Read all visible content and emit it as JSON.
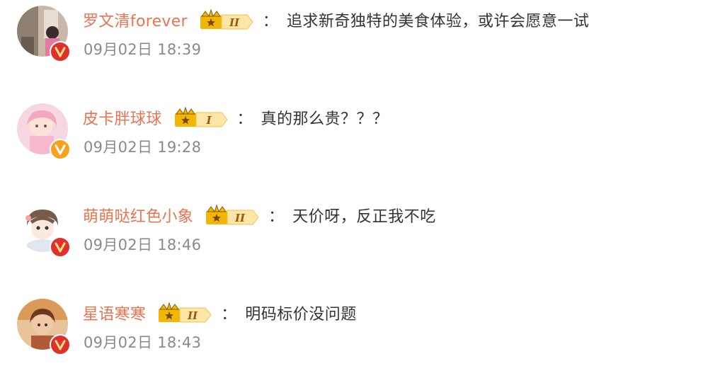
{
  "comments": [
    {
      "username": "罗文清forever",
      "rank": "II",
      "colon": "：",
      "text": "追求新奇独特的美食体验，或许会愿意一试",
      "time": "09月02日 18:39",
      "badge_color": "#e0302c"
    },
    {
      "username": "皮卡胖球球",
      "rank": "I",
      "colon": "：",
      "text": "真的那么贵？？？",
      "time": "09月02日 19:28",
      "badge_color": "#f7a21b"
    },
    {
      "username": "萌萌哒红色小象",
      "rank": "II",
      "colon": "：",
      "text": "天价呀，反正我不吃",
      "time": "09月02日 18:46",
      "badge_color": "#e0302c"
    },
    {
      "username": "星语寒寒",
      "rank": "II",
      "colon": "：",
      "text": "明码标价没问题",
      "time": "09月02日 18:43",
      "badge_color": "#e0302c"
    }
  ],
  "colors": {
    "username": "#eb7350",
    "text": "#333333",
    "time": "#8a8a8a",
    "crown": "#f2b705"
  }
}
